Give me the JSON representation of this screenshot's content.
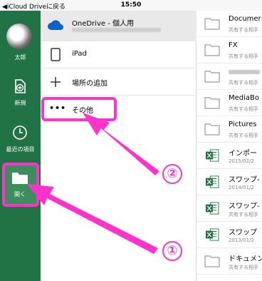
{
  "status_bar": {
    "back_label": "◀iCloud Driveに戻る",
    "time": "15:50"
  },
  "sidebar": {
    "user_name": "太郎",
    "items": [
      {
        "label": "新規",
        "icon": "new-document-icon"
      },
      {
        "label": "最近の項目",
        "icon": "clock-icon"
      },
      {
        "label": "開く",
        "icon": "folder-icon",
        "selected": true
      }
    ]
  },
  "locations": [
    {
      "label": "OneDrive - 個人用",
      "icon": "cloud-icon",
      "selected": true
    },
    {
      "label": "iPad",
      "icon": "tablet-icon"
    },
    {
      "label": "場所の追加",
      "icon": "plus-icon"
    },
    {
      "label": "その他",
      "icon": "more-icon"
    }
  ],
  "files": [
    {
      "name": "Documer",
      "sub": "共有する相手",
      "type": "folder"
    },
    {
      "name": "FX",
      "sub": "共有する相手",
      "type": "folder"
    },
    {
      "name": "",
      "sub": "共有する相手",
      "type": "folder"
    },
    {
      "name": "MediaBo",
      "sub": "共有する相手",
      "type": "folder"
    },
    {
      "name": "Pictures",
      "sub": "共有する相手",
      "type": "folder"
    },
    {
      "name": "インポー",
      "sub": "2015/02/2",
      "type": "excel"
    },
    {
      "name": "スワップ-",
      "sub": "2014/01/2",
      "type": "excel"
    },
    {
      "name": "スワップ-",
      "sub": "共有する相手",
      "type": "excel"
    },
    {
      "name": "スワップ",
      "sub": "2013/01/2",
      "type": "excel"
    },
    {
      "name": "ドキュメン",
      "sub": "共有する相手",
      "type": "folder"
    }
  ],
  "annotations": {
    "marker_1": "①",
    "marker_2": "②",
    "highlight_color": "#ff33cc"
  },
  "colors": {
    "sidebar": "#217346",
    "accent": "#ff33cc"
  }
}
